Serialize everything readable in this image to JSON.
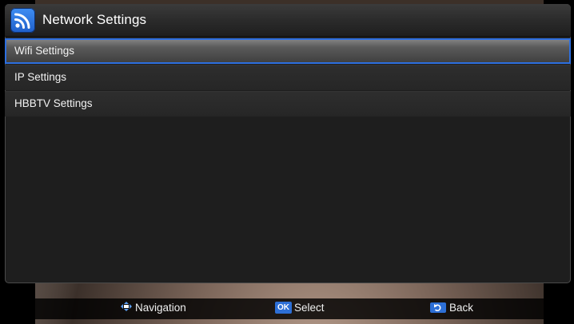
{
  "window": {
    "title": "Network Settings",
    "icon": "rss-network-icon"
  },
  "menu": {
    "items": [
      {
        "label": "Wifi Settings",
        "selected": true
      },
      {
        "label": "IP Settings",
        "selected": false
      },
      {
        "label": "HBBTV Settings",
        "selected": false
      }
    ]
  },
  "help": {
    "navigation_label": "Navigation",
    "ok_key": "OK",
    "select_label": "Select",
    "back_label": "Back"
  },
  "colors": {
    "accent": "#2d6fe0",
    "icon_blue": "#2f7be6"
  }
}
